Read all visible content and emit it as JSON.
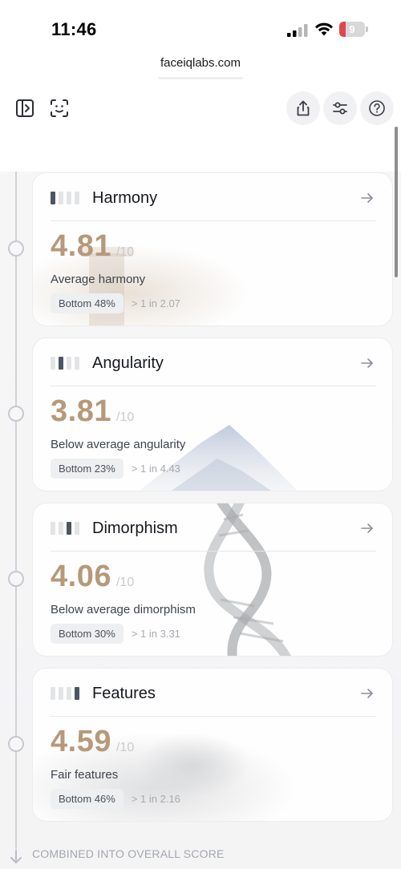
{
  "status": {
    "time": "11:46",
    "battery": "9",
    "battery_level": 0.09,
    "battery_color": "#e0474a"
  },
  "browser": {
    "url": "faceiqlabs.com"
  },
  "toolbar": {
    "sidebar_icon": "sidebar-toggle-icon",
    "scan_icon": "face-scan-icon",
    "share_icon": "share-icon",
    "filters_icon": "sliders-icon",
    "help_icon": "help-circle-icon"
  },
  "colors": {
    "score": "#b69979",
    "bar_active": "#4c5561",
    "bar_inactive": "#e3e4e6"
  },
  "cards": [
    {
      "title": "Harmony",
      "active_bar": 0,
      "score": "4.81",
      "denominator": "/10",
      "description": "Average harmony",
      "rank": "Bottom 48%",
      "ratio": "> 1 in 2.07",
      "decoration": "column-image"
    },
    {
      "title": "Angularity",
      "active_bar": 1,
      "score": "3.81",
      "denominator": "/10",
      "description": "Below average angularity",
      "rank": "Bottom 23%",
      "ratio": "> 1 in 4.43",
      "decoration": "mountain-image"
    },
    {
      "title": "Dimorphism",
      "active_bar": 2,
      "score": "4.06",
      "denominator": "/10",
      "description": "Below average dimorphism",
      "rank": "Bottom 30%",
      "ratio": "> 1 in 3.31",
      "decoration": "dna-helix-image"
    },
    {
      "title": "Features",
      "active_bar": 3,
      "score": "4.59",
      "denominator": "/10",
      "description": "Fair features",
      "rank": "Bottom 46%",
      "ratio": "> 1 in 2.16",
      "decoration": "rock-image"
    }
  ],
  "footer": {
    "label": "COMBINED INTO OVERALL SCORE"
  }
}
